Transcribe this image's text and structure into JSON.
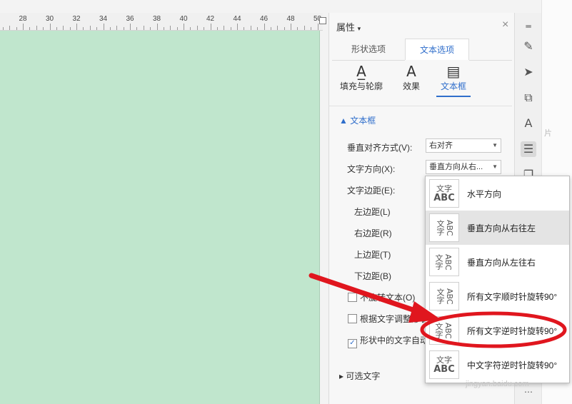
{
  "ruler": {
    "labels": [
      "28",
      "30",
      "32",
      "34",
      "36",
      "38",
      "40",
      "42",
      "44",
      "46",
      "48",
      "50"
    ]
  },
  "panel": {
    "title": "属性",
    "title_caret": "▾",
    "close": "×",
    "tabs": [
      {
        "label": "形状选项"
      },
      {
        "label": "文本选项"
      }
    ],
    "subtabs": [
      {
        "label": "填充与轮廓",
        "icon": "text-fill-icon"
      },
      {
        "label": "效果",
        "icon": "text-effect-icon"
      },
      {
        "label": "文本框",
        "icon": "text-box-icon"
      }
    ],
    "section": "▲ 文本框",
    "fields": {
      "valign_label": "垂直对齐方式(V):",
      "valign_value": "右对齐",
      "direction_label": "文字方向(X):",
      "direction_value": "垂直方向从右...",
      "margin_label": "文字边距(E):",
      "left_margin": "左边距(L)",
      "right_margin": "右边距(R)",
      "top_margin": "上边距(T)",
      "bottom_margin": "下边距(B)"
    },
    "checks": [
      {
        "label": "不旋转文本(O)",
        "checked": false
      },
      {
        "label": "根据文字调整形状",
        "checked": false
      },
      {
        "label": "形状中的文字自动",
        "checked": true
      }
    ],
    "optional_text": "▸ 可选文字"
  },
  "dropdown": {
    "options": [
      {
        "label": "水平方向",
        "icon_text": "文字 ABC"
      },
      {
        "label": "垂直方向从右往左",
        "icon_text": "ABC 文字"
      },
      {
        "label": "垂直方向从左往右",
        "icon_text": "文字 ABC"
      },
      {
        "label": "所有文字顺时针旋转90°",
        "icon_text": "ABC 文字"
      },
      {
        "label": "所有文字逆时针旋转90°",
        "icon_text": "文字 ABC"
      },
      {
        "label": "中文字符逆时针旋转90°",
        "icon_text": "文字 ABC"
      }
    ],
    "selected_index": 1
  },
  "toolbar": {
    "tools": [
      "pen-icon",
      "cursor-icon",
      "shapes-icon",
      "text-style-icon",
      "settings-sliders-icon",
      "layers-icon"
    ]
  },
  "side_text": "片",
  "watermark": "jingyan.baidu.com",
  "colors": {
    "canvas": "#c0e6cd",
    "accent": "#2f6ecb",
    "annotation": "#e0161e"
  }
}
